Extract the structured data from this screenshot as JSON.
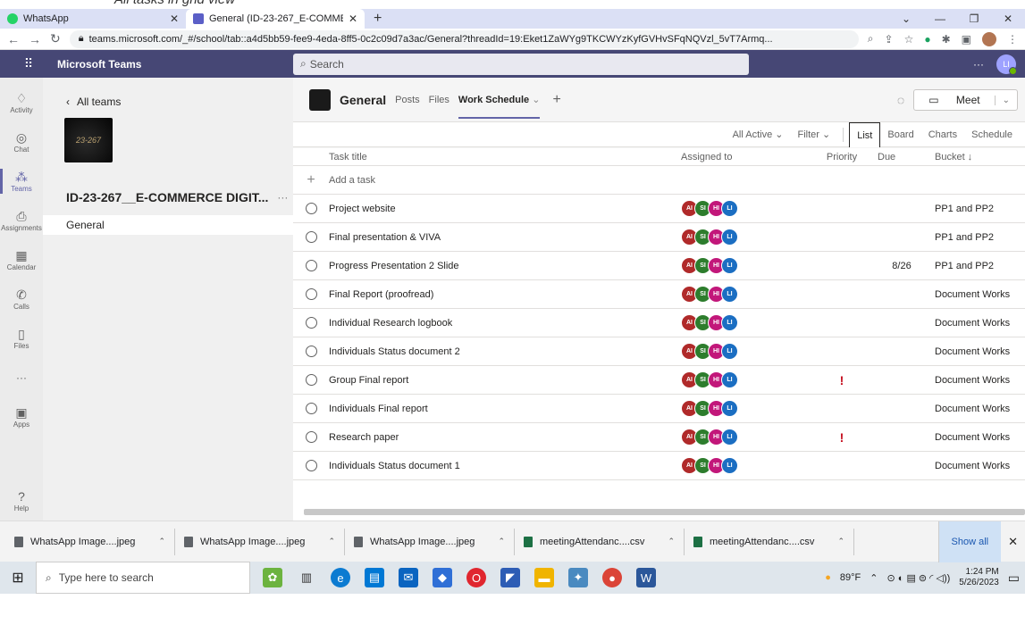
{
  "browser": {
    "tabs": [
      {
        "label": "WhatsApp"
      },
      {
        "label": "General (ID-23-267_E-COMMER"
      }
    ],
    "url": "teams.microsoft.com/_#/school/tab::a4d5bb59-fee9-4eda-8ff5-0c2c09d7a3ac/General?threadId=19:Eket1ZaWYg9TKCWYzKyfGVHvSFqNQVzl_5vT7Armq..."
  },
  "teams": {
    "app_name": "Microsoft Teams",
    "search_placeholder": "Search",
    "user_initials": "LI",
    "more": "···"
  },
  "rail": [
    {
      "label": "Activity",
      "icon": "bell-icon"
    },
    {
      "label": "Chat",
      "icon": "chat-icon"
    },
    {
      "label": "Teams",
      "icon": "teams-icon"
    },
    {
      "label": "Assignments",
      "icon": "assignments-icon"
    },
    {
      "label": "Calendar",
      "icon": "calendar-icon"
    },
    {
      "label": "Calls",
      "icon": "phone-icon"
    },
    {
      "label": "Files",
      "icon": "file-icon"
    },
    {
      "label": "···",
      "icon": "more-icon"
    },
    {
      "label": "Apps",
      "icon": "apps-icon"
    }
  ],
  "rail_help": "Help",
  "sidebar": {
    "back": "All teams",
    "team_logo_text": "23-267",
    "team_name": "ID-23-267__E-COMMERCE DIGIT...",
    "team_more": "···",
    "channel": "General"
  },
  "channel": {
    "title": "General",
    "tabs": [
      "Posts",
      "Files",
      "Work Schedule"
    ],
    "meet": "Meet"
  },
  "toolbar": {
    "filter_active": "All Active",
    "filter": "Filter",
    "views": [
      "List",
      "Board",
      "Charts",
      "Schedule"
    ]
  },
  "grid": {
    "headers": {
      "title": "Task title",
      "assigned": "Assigned to",
      "priority": "Priority",
      "due": "Due",
      "bucket": "Bucket ↓"
    },
    "add_task": "Add a task",
    "assignees": [
      "AI",
      "SI",
      "HI",
      "LI"
    ],
    "tasks": [
      {
        "title": "Project website",
        "priority": "",
        "due": "",
        "bucket": "PP1 and PP2"
      },
      {
        "title": "Final presentation & VIVA",
        "priority": "",
        "due": "",
        "bucket": "PP1 and PP2"
      },
      {
        "title": "Progress Presentation 2 Slide",
        "priority": "",
        "due": "8/26",
        "bucket": "PP1 and PP2"
      },
      {
        "title": "Final Report (proofread)",
        "priority": "",
        "due": "",
        "bucket": "Document Works"
      },
      {
        "title": "Individual Research logbook",
        "priority": "",
        "due": "",
        "bucket": "Document Works"
      },
      {
        "title": "Individuals Status document 2",
        "priority": "",
        "due": "",
        "bucket": "Document Works"
      },
      {
        "title": "Group Final report",
        "priority": "!",
        "due": "",
        "bucket": "Document Works"
      },
      {
        "title": "Individuals Final report",
        "priority": "",
        "due": "",
        "bucket": "Document Works"
      },
      {
        "title": "Research paper",
        "priority": "!",
        "due": "",
        "bucket": "Document Works"
      },
      {
        "title": "Individuals Status document 1",
        "priority": "",
        "due": "",
        "bucket": "Document Works"
      }
    ]
  },
  "downloads": [
    {
      "name": "WhatsApp Image....jpeg",
      "type": "image"
    },
    {
      "name": "WhatsApp Image....jpeg",
      "type": "image"
    },
    {
      "name": "WhatsApp Image....jpeg",
      "type": "image"
    },
    {
      "name": "meetingAttendanc....csv",
      "type": "csv"
    },
    {
      "name": "meetingAttendanc....csv",
      "type": "csv"
    }
  ],
  "show_all": "Show all",
  "taskbar": {
    "search_placeholder": "Type here to search",
    "weather": "89°F",
    "time": "1:24 PM",
    "date": "5/26/2023"
  },
  "top_caption": "All tasks in grid view"
}
